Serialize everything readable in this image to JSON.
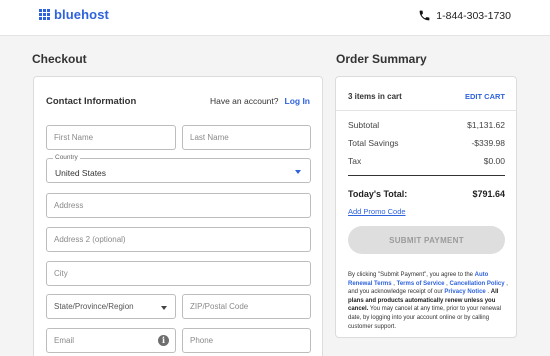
{
  "header": {
    "logo_text": "bluehost",
    "phone": "1-844-303-1730"
  },
  "checkout": {
    "title": "Checkout",
    "contact_title": "Contact Information",
    "account_prompt": "Have an account?",
    "login_label": "Log In",
    "fields": {
      "first_name": "First Name",
      "last_name": "Last Name",
      "country_label": "Country",
      "country_value": "United States",
      "address": "Address",
      "address2": "Address 2 (optional)",
      "city": "City",
      "state": "State/Province/Region",
      "zip": "ZIP/Postal Code",
      "email": "Email",
      "phone": "Phone"
    }
  },
  "summary": {
    "title": "Order Summary",
    "items_in_cart": "3 items in cart",
    "edit_cart": "EDIT CART",
    "rows": [
      {
        "label": "Subtotal",
        "amount": "$1,131.62"
      },
      {
        "label": "Total Savings",
        "amount": "-$339.98"
      },
      {
        "label": "Tax",
        "amount": "$0.00"
      }
    ],
    "total_label": "Today's Total:",
    "total_amount": "$791.64",
    "promo_link": "Add Promo Code",
    "submit_label": "SUBMIT PAYMENT",
    "terms": {
      "t1": "By clicking \"Submit Payment\", you agree to the ",
      "l1": "Auto Renewal Terms",
      "t2": " , ",
      "l2": "Terms of Service",
      "t3": " , ",
      "l3": "Cancellation Policy",
      "t4": " , and you acknowledge receipt of our ",
      "l4": "Privacy Notice",
      "t5": " . ",
      "b1": "All plans and products automatically renew unless you cancel.",
      "t6": " You may cancel at any time, prior to your renewal date, by logging into your account online or by calling customer support."
    }
  },
  "colors": {
    "brand_blue": "#2f63dc",
    "background": "#f4f4f5"
  },
  "icons": [
    "logo-grid-icon",
    "phone-icon",
    "chevron-down-icon",
    "info-icon"
  ]
}
